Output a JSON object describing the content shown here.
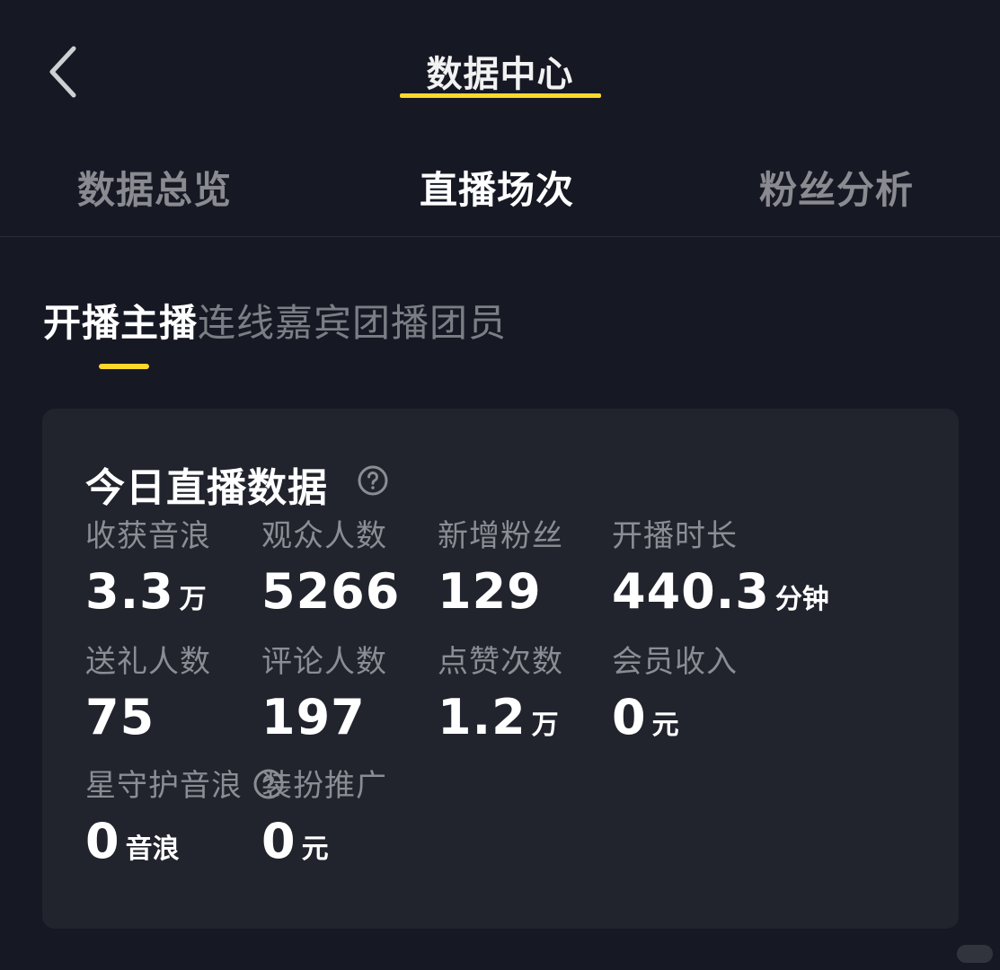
{
  "header": {
    "title": "数据中心",
    "back_icon": "chevron-left-icon"
  },
  "tabs": [
    {
      "label": "数据总览",
      "active": false
    },
    {
      "label": "直播场次",
      "active": true
    },
    {
      "label": "粉丝分析",
      "active": false
    }
  ],
  "subtabs": [
    {
      "label": "开播主播",
      "active": true
    },
    {
      "label": "连线嘉宾",
      "active": false
    },
    {
      "label": "团播团员",
      "active": false
    }
  ],
  "card": {
    "title": "今日直播数据",
    "help_icon": "question-circle-icon",
    "metrics": [
      {
        "label": "收获音浪",
        "value": "3.3",
        "unit": "万"
      },
      {
        "label": "观众人数",
        "value": "5266",
        "unit": ""
      },
      {
        "label": "新增粉丝",
        "value": "129",
        "unit": ""
      },
      {
        "label": "开播时长",
        "value": "440.3",
        "unit": "分钟"
      },
      {
        "label": "送礼人数",
        "value": "75",
        "unit": ""
      },
      {
        "label": "评论人数",
        "value": "197",
        "unit": ""
      },
      {
        "label": "点赞次数",
        "value": "1.2",
        "unit": "万"
      },
      {
        "label": "会员收入",
        "value": "0",
        "unit": "元"
      },
      {
        "label": "星守护音浪",
        "value": "0",
        "unit": "音浪"
      },
      {
        "label": "装扮推广",
        "value": "0",
        "unit": "元"
      }
    ]
  },
  "colors": {
    "background": "#161823",
    "card": "#21232d",
    "accent": "#fdd82a",
    "muted": "#8b8d94"
  }
}
